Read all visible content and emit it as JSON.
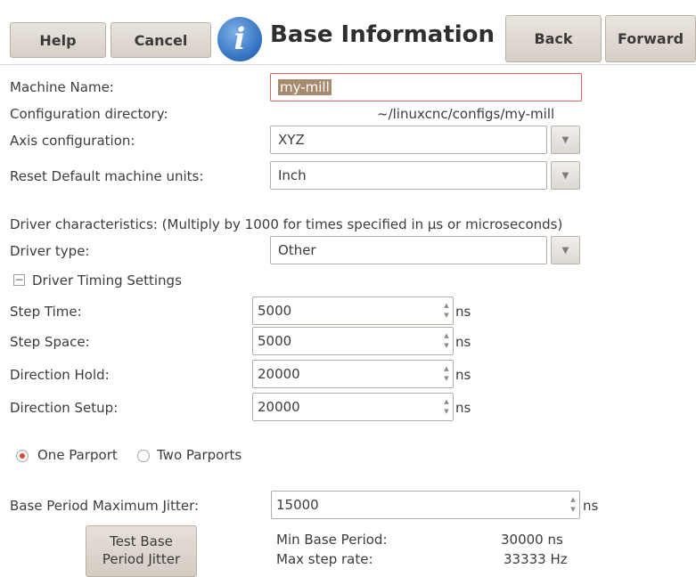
{
  "header": {
    "help_label": "Help",
    "cancel_label": "Cancel",
    "info_icon": "i",
    "title": "Base Information",
    "back_label": "Back",
    "forward_label": "Forward"
  },
  "machine_name": {
    "label": "Machine Name:",
    "value": "my-mill"
  },
  "config_dir": {
    "label": "Configuration directory:",
    "value": "~/linuxcnc/configs/my-mill"
  },
  "axis_config": {
    "label": "Axis configuration:",
    "value": "XYZ"
  },
  "machine_units": {
    "label": "Reset Default machine units:",
    "value": "Inch"
  },
  "driver": {
    "characteristics_text": "Driver characteristics: (Multiply by 1000 for times specified in µs or microseconds)",
    "type_label": "Driver type:",
    "type_value": "Other",
    "timing_expander_symbol": "−",
    "timing_expander_label": "Driver Timing Settings"
  },
  "timings": [
    {
      "label": "Step Time:",
      "value": "5000",
      "unit": "ns"
    },
    {
      "label": "Step Space:",
      "value": "5000",
      "unit": "ns"
    },
    {
      "label": "Direction Hold:",
      "value": "20000",
      "unit": "ns"
    },
    {
      "label": "Direction Setup:",
      "value": "20000",
      "unit": "ns"
    }
  ],
  "parport": {
    "one_label": "One Parport",
    "two_label": "Two Parports",
    "selected": "one"
  },
  "jitter": {
    "label": "Base Period Maximum Jitter:",
    "value": "15000",
    "unit": "ns"
  },
  "test_button": {
    "line1": "Test Base",
    "line2": "Period Jitter"
  },
  "results": {
    "min_period_label": "Min Base Period:",
    "min_period_value": "30000 ns",
    "max_step_label": "Max step rate:",
    "max_step_value": "33333 Hz"
  },
  "colors": {
    "radio_selected": "#e04a2f",
    "error_border": "#d9635a",
    "selection_bg": "#a88b6e"
  }
}
